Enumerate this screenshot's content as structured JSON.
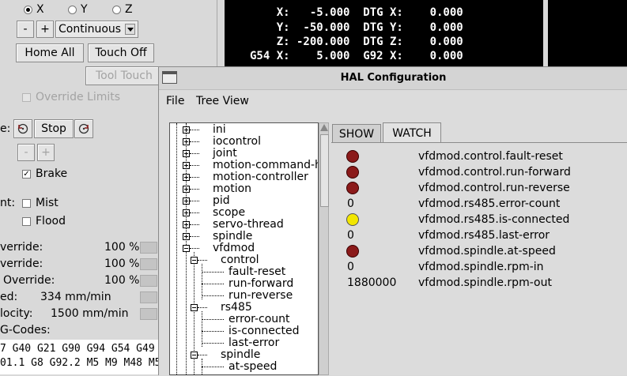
{
  "axis_select": {
    "options": [
      "X",
      "Y",
      "Z"
    ],
    "selected": "X"
  },
  "jog": {
    "minus": "-",
    "plus": "+",
    "mode": "Continuous"
  },
  "buttons": {
    "home_all": "Home All",
    "touch_off": "Touch Off",
    "tool_touch": "Tool Touch"
  },
  "override_limits": {
    "label": "Override Limits",
    "checked": false
  },
  "spindle": {
    "label_fragment": "e:",
    "stop": "Stop",
    "minus": "-",
    "plus": "+",
    "brake": "Brake",
    "brake_checked": true
  },
  "coolant": {
    "label_fragment": "nt:",
    "mist": "Mist",
    "flood": "Flood"
  },
  "overrides": [
    {
      "label": "verride:",
      "value": "100 %"
    },
    {
      "label": "verride:",
      "value": "100 %"
    },
    {
      "label": "Override:",
      "value": "100 %"
    }
  ],
  "speeds": [
    {
      "label": "ed:",
      "value": "334 mm/min"
    },
    {
      "label": "locity:",
      "value": "1500 mm/min"
    }
  ],
  "gcodes_label": "G-Codes:",
  "gcodes": [
    "7 G40 G21 G90 G94 G54 G49",
    "01.1 G8 G92.2 M5 M9 M48 M5"
  ],
  "dro_lines": [
    "    X:   -5.000  DTG X:    0.000",
    "    Y:  -50.000  DTG Y:    0.000",
    "    Z: -200.000  DTG Z:    0.000",
    "G54 X:    5.000  G92 X:    0.000"
  ],
  "hal": {
    "title": "HAL Configuration",
    "menu": [
      "File",
      "Tree View"
    ],
    "tabs": {
      "show": "SHOW",
      "watch": "WATCH",
      "active": "WATCH"
    },
    "tree": [
      "ini",
      "iocontrol",
      "joint",
      "motion-command-ha",
      "motion-controller",
      "motion",
      "pid",
      "scope",
      "servo-thread",
      "spindle",
      "vfdmod",
      "control",
      "fault-reset",
      "run-forward",
      "run-reverse",
      "rs485",
      "error-count",
      "is-connected",
      "last-error",
      "spindle",
      "at-speed"
    ],
    "watch": [
      {
        "kind": "led",
        "state": "off",
        "color": "#8b1a1a",
        "name": "vfdmod.control.fault-reset"
      },
      {
        "kind": "led",
        "state": "off",
        "color": "#8b1a1a",
        "name": "vfdmod.control.run-forward"
      },
      {
        "kind": "led",
        "state": "off",
        "color": "#8b1a1a",
        "name": "vfdmod.control.run-reverse"
      },
      {
        "kind": "value",
        "value": "0",
        "name": "vfdmod.rs485.error-count"
      },
      {
        "kind": "led",
        "state": "on",
        "color": "#f2e600",
        "name": "vfdmod.rs485.is-connected"
      },
      {
        "kind": "value",
        "value": "0",
        "name": "vfdmod.rs485.last-error"
      },
      {
        "kind": "led",
        "state": "off",
        "color": "#8b1a1a",
        "name": "vfdmod.spindle.at-speed"
      },
      {
        "kind": "value",
        "value": "0",
        "name": "vfdmod.spindle.rpm-in"
      },
      {
        "kind": "value",
        "value": "1880000",
        "name": "vfdmod.spindle.rpm-out"
      }
    ]
  }
}
